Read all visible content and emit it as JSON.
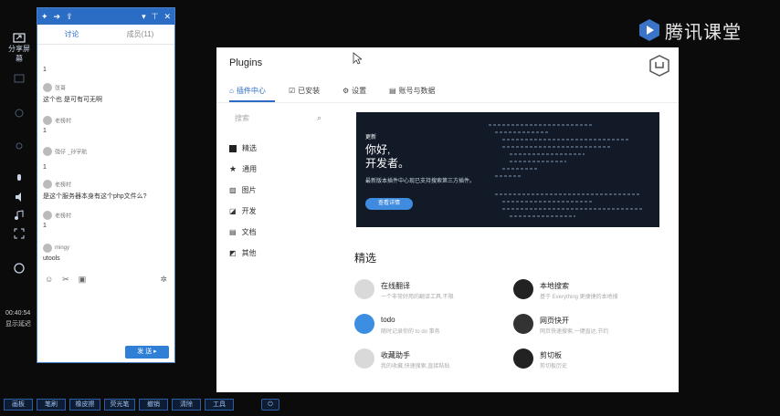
{
  "left_toolbar": {
    "share_screen_label": "分享屏幕",
    "mic_label": "",
    "clock": "00:40:54",
    "status_label": "显示延迟"
  },
  "chat": {
    "tabs": [
      "讨论",
      "成员(11)"
    ],
    "messages": [
      {
        "name": "",
        "text": "1"
      },
      {
        "name": "张哥",
        "text": "这个也 是可有可无啊"
      },
      {
        "name": "老榜村",
        "text": "1"
      },
      {
        "name": "强仔",
        "text": "_孙宇航"
      },
      {
        "name": "",
        "text": "1"
      },
      {
        "name": "老榜村",
        "text": "是这个服务器本身有这个php文件么?"
      },
      {
        "name": "老榜村",
        "text": "1"
      },
      {
        "name": "mingy",
        "text": "utools"
      }
    ],
    "send_label": "发 送"
  },
  "bottom_bar": {
    "buttons": [
      "画板",
      "笔刷",
      "橡皮擦",
      "荧光笔",
      "撤销",
      "清除",
      "工具"
    ]
  },
  "brand": {
    "text": "腾讯课堂"
  },
  "plugins": {
    "title": "Plugins",
    "tabs": [
      "插件中心",
      "已安装",
      "设置",
      "账号与数据"
    ],
    "search_placeholder": "搜索",
    "categories": [
      "精选",
      "通用",
      "图片",
      "开发",
      "文档",
      "其他"
    ],
    "banner": {
      "small": "更新",
      "headline1": "你好,",
      "headline2": "开发者。",
      "desc": "最新版本插件中心现已支持搜索第三方插件。",
      "button": "查看详情"
    },
    "featured_title": "精选",
    "items": [
      {
        "name": "在线翻译",
        "desc": "一个非常好用的翻译工具,不限"
      },
      {
        "name": "本地搜索",
        "desc": "基于 Everything 更便捷的本地搜"
      },
      {
        "name": "todo",
        "desc": "随时记录你的 to do 事务"
      },
      {
        "name": "网页快开",
        "desc": "网页快速搜索,一键直达,节约"
      },
      {
        "name": "收藏助手",
        "desc": "我的收藏,快速搜索,直接粘贴"
      },
      {
        "name": "剪切板",
        "desc": "剪切板历史"
      }
    ]
  },
  "colors": {
    "accent": "#2b6cc4",
    "banner_bg": "#111a26"
  }
}
